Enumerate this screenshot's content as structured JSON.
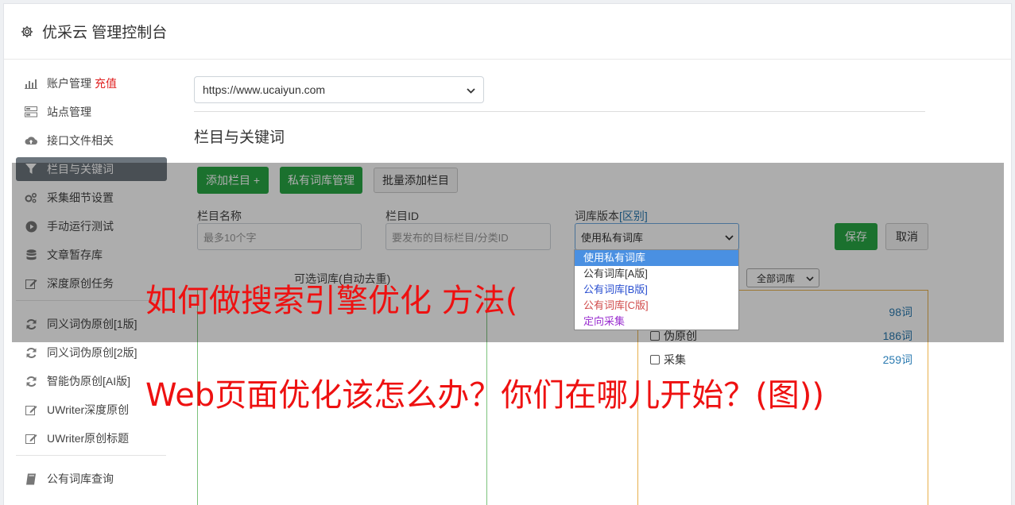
{
  "header": {
    "title": "优采云 管理控制台"
  },
  "sidebar": {
    "items": [
      {
        "label": "账户管理",
        "extra": "充值",
        "icon": "bar-chart-icon"
      },
      {
        "label": "站点管理",
        "icon": "server-icon"
      },
      {
        "label": "接口文件相关",
        "icon": "cloud-upload-icon"
      },
      {
        "label": "栏目与关键词",
        "icon": "filter-icon",
        "active": true
      },
      {
        "label": "采集细节设置",
        "icon": "gears-icon"
      },
      {
        "label": "手动运行测试",
        "icon": "play-circle-icon"
      },
      {
        "label": "文章暂存库",
        "icon": "database-icon"
      },
      {
        "label": "深度原创任务",
        "icon": "edit-icon"
      },
      {
        "label": "同义词伪原创[1版]",
        "icon": "refresh-icon"
      },
      {
        "label": "同义词伪原创[2版]",
        "icon": "refresh-icon"
      },
      {
        "label": "智能伪原创[AI版]",
        "icon": "refresh-icon"
      },
      {
        "label": "UWriter深度原创",
        "icon": "edit-icon"
      },
      {
        "label": "UWriter原创标题",
        "icon": "edit-icon"
      },
      {
        "label": "公有词库查询",
        "icon": "book-icon"
      }
    ]
  },
  "main": {
    "site_select": "https://www.ucaiyun.com",
    "section_title": "栏目与关键词",
    "buttons": {
      "add_column": "添加栏目 +",
      "private_lib": "私有词库管理",
      "batch_add": "批量添加栏目",
      "save": "保存",
      "cancel": "取消"
    },
    "form": {
      "name_label": "栏目名称",
      "name_placeholder": "最多10个字",
      "id_label": "栏目ID",
      "id_placeholder": "要发布的目标栏目/分类ID",
      "version_label": "词库版本",
      "version_link": "[区别]",
      "version_value": "使用私有词库"
    },
    "dropdown_options": [
      {
        "label": "使用私有词库",
        "color": "#ffffff",
        "selected": true
      },
      {
        "label": "公有词库[A版]",
        "color": "#333333"
      },
      {
        "label": "公有词库[B版]",
        "color": "#2a4fd0"
      },
      {
        "label": "公有词库[C版]",
        "color": "#d04a4a"
      },
      {
        "label": "定向采集",
        "color": "#9b30d0"
      }
    ],
    "candidate_label": "可选词库(自动去重)",
    "filter_select": "全部词库",
    "keyword_rows": [
      {
        "label": "",
        "count": "98词"
      },
      {
        "label": "伪原创",
        "count": "186词"
      },
      {
        "label": "采集",
        "count": "259词"
      }
    ]
  },
  "overlay_text": {
    "line1": "如何做搜索引擎优化 方法(",
    "line2": "Web页面优化该怎么办？你们在哪儿开始？(图))"
  },
  "colors": {
    "accent_green": "#28a745",
    "active_nav": "#6c757d",
    "overlay_red": "#ee1111",
    "link_blue": "#2a7ab0"
  }
}
